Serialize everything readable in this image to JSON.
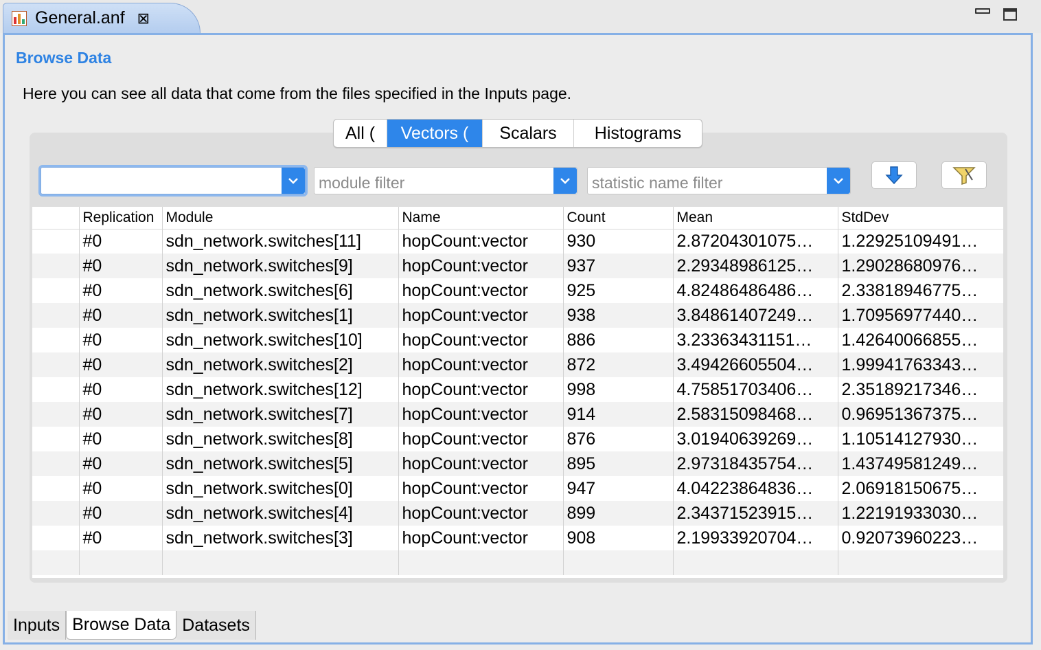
{
  "editor": {
    "tab_title": "General.anf",
    "file_icon": "analysis-file-icon",
    "close_icon": "close-icon"
  },
  "form": {
    "title": "Browse Data",
    "description": "Here you can see all data that come from the files specified in the Inputs page."
  },
  "segments": [
    {
      "label": "All (",
      "active": false
    },
    {
      "label": "Vectors (",
      "active": true
    },
    {
      "label": "Scalars",
      "active": false
    },
    {
      "label": "Histograms",
      "active": false
    }
  ],
  "filters": {
    "run_value": "",
    "module_placeholder": "module filter",
    "statistic_placeholder": "statistic name filter"
  },
  "table": {
    "columns": [
      "",
      "Replication",
      "Module",
      "Name",
      "Count",
      "Mean",
      "StdDev"
    ],
    "rows": [
      [
        "",
        "#0",
        "sdn_network.switches[11]",
        "hopCount:vector",
        "930",
        "2.87204301075…",
        "1.22925109491…"
      ],
      [
        "",
        "#0",
        "sdn_network.switches[9]",
        "hopCount:vector",
        "937",
        "2.29348986125…",
        "1.29028680976…"
      ],
      [
        "",
        "#0",
        "sdn_network.switches[6]",
        "hopCount:vector",
        "925",
        "4.82486486486…",
        "2.33818946775…"
      ],
      [
        "",
        "#0",
        "sdn_network.switches[1]",
        "hopCount:vector",
        "938",
        "3.84861407249…",
        "1.70956977440…"
      ],
      [
        "",
        "#0",
        "sdn_network.switches[10]",
        "hopCount:vector",
        "886",
        "3.23363431151…",
        "1.42640066855…"
      ],
      [
        "",
        "#0",
        "sdn_network.switches[2]",
        "hopCount:vector",
        "872",
        "3.49426605504…",
        "1.99941763343…"
      ],
      [
        "",
        "#0",
        "sdn_network.switches[12]",
        "hopCount:vector",
        "998",
        "4.75851703406…",
        "2.35189217346…"
      ],
      [
        "",
        "#0",
        "sdn_network.switches[7]",
        "hopCount:vector",
        "914",
        "2.58315098468…",
        "0.96951367375…"
      ],
      [
        "",
        "#0",
        "sdn_network.switches[8]",
        "hopCount:vector",
        "876",
        "3.01940639269…",
        "1.10514127930…"
      ],
      [
        "",
        "#0",
        "sdn_network.switches[5]",
        "hopCount:vector",
        "895",
        "2.97318435754…",
        "1.43749581249…"
      ],
      [
        "",
        "#0",
        "sdn_network.switches[0]",
        "hopCount:vector",
        "947",
        "4.04223864836…",
        "2.06918150675…"
      ],
      [
        "",
        "#0",
        "sdn_network.switches[4]",
        "hopCount:vector",
        "899",
        "2.34371523915…",
        "1.22191933030…"
      ],
      [
        "",
        "#0",
        "sdn_network.switches[3]",
        "hopCount:vector",
        "908",
        "2.19933920704…",
        "0.92073960223…"
      ]
    ]
  },
  "page_tabs": [
    {
      "label": "Inputs",
      "active": false
    },
    {
      "label": "Browse Data",
      "active": true
    },
    {
      "label": "Datasets",
      "active": false
    }
  ],
  "colors": {
    "accent": "#2e86ea",
    "title": "#2f83e3",
    "frame_border": "#86b0e6"
  }
}
